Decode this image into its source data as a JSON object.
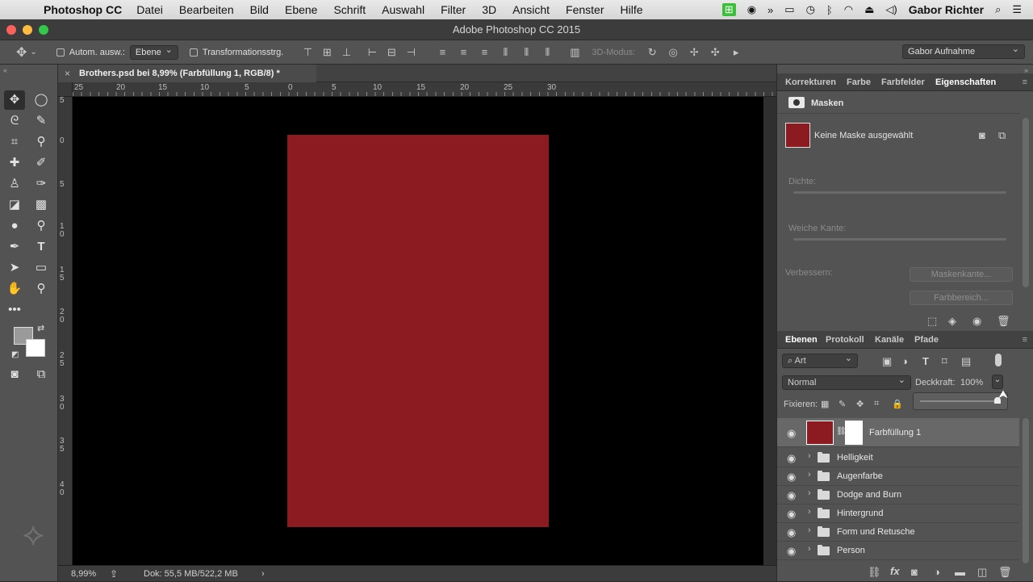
{
  "menubar": {
    "app": "Photoshop CC",
    "items": [
      "Datei",
      "Bearbeiten",
      "Bild",
      "Ebene",
      "Schrift",
      "Auswahl",
      "Filter",
      "3D",
      "Ansicht",
      "Fenster",
      "Hilfe"
    ],
    "user": "Gabor Richter"
  },
  "window": {
    "title": "Adobe Photoshop CC 2015"
  },
  "options": {
    "auto_select_label": "Autom. ausw.:",
    "auto_select_value": "Ebene",
    "transform_label": "Transformationsstrg.",
    "mode_3d_label": "3D-Modus:",
    "workspace": "Gabor Aufnahme"
  },
  "document": {
    "tab_title": "Brothers.psd bei 8,99% (Farbfüllung 1, RGB/8) *",
    "ruler_h": [
      "25",
      "20",
      "15",
      "10",
      "5",
      "0",
      "5",
      "10",
      "15",
      "20",
      "25",
      "30"
    ],
    "ruler_v": [
      "5",
      "0",
      "5",
      "10",
      "15",
      "20",
      "25",
      "30",
      "35",
      "40"
    ],
    "fill_color": "#8c1a21"
  },
  "status": {
    "zoom": "8,99%",
    "doc_size": "Dok: 55,5 MB/522,2 MB"
  },
  "properties": {
    "tabs": [
      "Korrekturen",
      "Farbe",
      "Farbfelder",
      "Eigenschaften"
    ],
    "active_tab": "Eigenschaften",
    "section": "Masken",
    "no_mask": "Keine Maske ausgewählt",
    "density_label": "Dichte:",
    "feather_label": "Weiche Kante:",
    "refine_label": "Verbessern:",
    "mask_edge_button": "Maskenkante...",
    "color_range_button": "Farbbereich..."
  },
  "layers": {
    "tabs": [
      "Ebenen",
      "Protokoll",
      "Kanäle",
      "Pfade"
    ],
    "filter_kind": "Art",
    "blend_mode": "Normal",
    "opacity_label": "Deckkraft:",
    "opacity_value": "100%",
    "lock_label": "Fixieren:",
    "items": [
      {
        "name": "Farbfüllung 1",
        "type": "fill",
        "selected": true
      },
      {
        "name": "Helligkeit",
        "type": "group"
      },
      {
        "name": "Augenfarbe",
        "type": "group"
      },
      {
        "name": "Dodge and Burn",
        "type": "group"
      },
      {
        "name": "Hintergrund",
        "type": "group"
      },
      {
        "name": "Form und Retusche",
        "type": "group"
      },
      {
        "name": "Person",
        "type": "group"
      }
    ]
  }
}
